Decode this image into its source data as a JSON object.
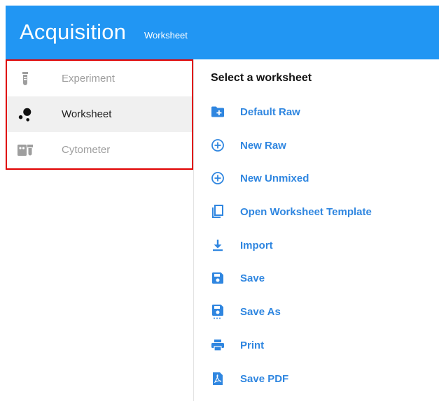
{
  "header": {
    "title": "Acquisition",
    "subtitle": "Worksheet"
  },
  "sidebar": {
    "items": [
      {
        "label": "Experiment",
        "icon": "test-tube-icon",
        "active": false
      },
      {
        "label": "Worksheet",
        "icon": "dots-icon",
        "active": true
      },
      {
        "label": "Cytometer",
        "icon": "cytometer-icon",
        "active": false
      }
    ]
  },
  "panel": {
    "title": "Select a worksheet",
    "actions": [
      {
        "label": "Default Raw",
        "icon": "folder-plus-icon"
      },
      {
        "label": "New Raw",
        "icon": "circle-plus-icon"
      },
      {
        "label": "New Unmixed",
        "icon": "circle-plus-icon"
      },
      {
        "label": "Open Worksheet Template",
        "icon": "copy-template-icon"
      },
      {
        "label": "Import",
        "icon": "download-icon"
      },
      {
        "label": "Save",
        "icon": "floppy-icon"
      },
      {
        "label": "Save As",
        "icon": "floppy-dots-icon"
      },
      {
        "label": "Print",
        "icon": "printer-icon"
      },
      {
        "label": "Save PDF",
        "icon": "pdf-icon"
      }
    ]
  },
  "colors": {
    "header": "#2196f3",
    "accent": "#2f86e0",
    "highlight": "#e00000",
    "muted": "#9e9e9e"
  }
}
